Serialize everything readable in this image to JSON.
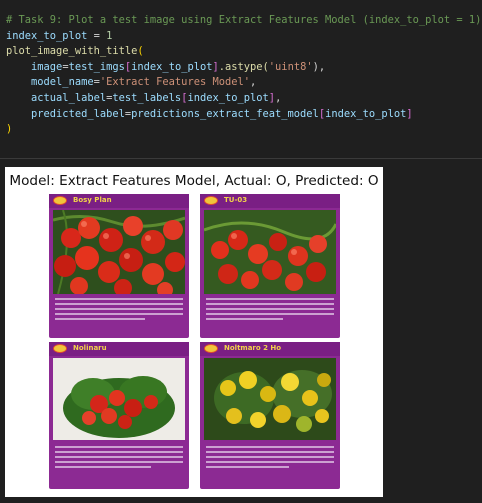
{
  "code": {
    "comment": "# Task 9: Plot a test image using Extract Features Model (index_to_plot = 1)",
    "line2_var": "index_to_plot",
    "line2_eq": " = ",
    "line2_num": "1",
    "line3_fn": "plot_image_with_title",
    "line3_open": "(",
    "line4_param": "image",
    "line4_eq": "=",
    "line4_var": "test_imgs",
    "line4_idx_open": "[",
    "line4_idx_var": "index_to_plot",
    "line4_idx_close": "]",
    "line4_method": ".astype(",
    "line4_str": "'uint8'",
    "line4_end": "),",
    "line5_param": "model_name",
    "line5_eq": "=",
    "line5_str": "'Extract Features Model'",
    "line5_end": ",",
    "line6_param": "actual_label",
    "line6_eq": "=",
    "line6_var": "test_labels",
    "line6_idx_open": "[",
    "line6_idx_var": "index_to_plot",
    "line6_idx_close": "]",
    "line6_end": ",",
    "line7_param": "predicted_label",
    "line7_eq": "=",
    "line7_var": "predictions_extract_feat_model",
    "line7_idx_open": "[",
    "line7_idx_var": "index_to_plot",
    "line7_idx_close": "]",
    "line8_close": ")"
  },
  "figure": {
    "title": "Model: Extract Features Model, Actual: O, Predicted: O",
    "panels": [
      {
        "label": "Bosy Plan"
      },
      {
        "label": "TU-03"
      },
      {
        "label": "Nolinaru"
      },
      {
        "label": "Noltmaro 2 Ho"
      }
    ]
  },
  "colors": {
    "background": "#1f1f1f",
    "comment": "#6a9955",
    "function": "#dcdcaa",
    "variable": "#9cdcfe",
    "number": "#b5cea8",
    "string": "#ce9178",
    "panel_purple": "#8c2a93",
    "panel_label": "#f2d34a"
  }
}
